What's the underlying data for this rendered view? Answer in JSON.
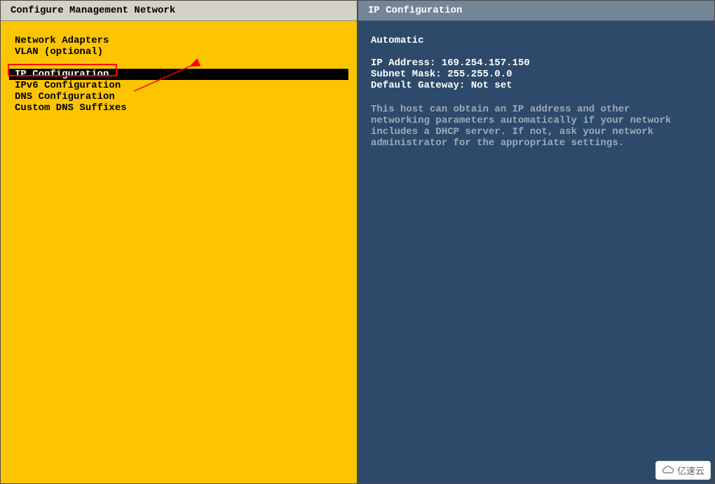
{
  "left": {
    "title": "Configure Management Network",
    "menu": [
      {
        "label": "Network Adapters"
      },
      {
        "label": "VLAN (optional)"
      },
      {
        "label": ""
      },
      {
        "label": "IP Configuration",
        "selected": true
      },
      {
        "label": "IPv6 Configuration"
      },
      {
        "label": "DNS Configuration"
      },
      {
        "label": "Custom DNS Suffixes"
      }
    ]
  },
  "right": {
    "title": "IP Configuration",
    "mode": "Automatic",
    "fields": [
      "IP Address: 169.254.157.150",
      "Subnet Mask: 255.255.0.0",
      "Default Gateway: Not set"
    ],
    "help": "This host can obtain an IP address and other networking parameters automatically if your network includes a DHCP server. If not, ask your network administrator for the appropriate settings."
  },
  "watermark": "亿速云"
}
